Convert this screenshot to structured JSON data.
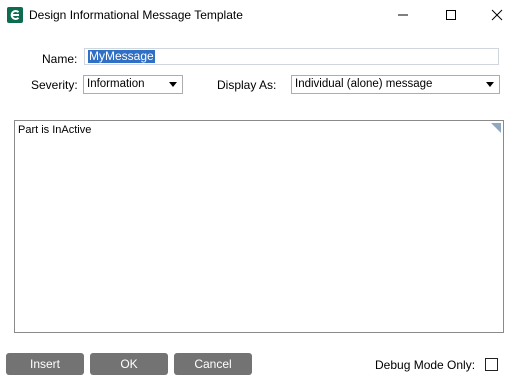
{
  "window": {
    "title": "Design Informational Message Template",
    "app_icon": "e-logo-icon",
    "controls": [
      "minimize-icon",
      "maximize-icon",
      "close-icon"
    ]
  },
  "form": {
    "name_label": "Name:",
    "name_value": "MyMessage",
    "severity_label": "Severity:",
    "severity_value": "Information",
    "display_as_label": "Display As:",
    "display_as_value": "Individual (alone) message"
  },
  "message": {
    "text": "Part is InActive"
  },
  "buttons": {
    "insert": "Insert",
    "ok": "OK",
    "cancel": "Cancel"
  },
  "debug": {
    "label": "Debug Mode Only:",
    "checked": false
  },
  "colors": {
    "button_bg": "#737373",
    "selection": "#2f6fc6",
    "app_icon": "#0d6b4f"
  }
}
